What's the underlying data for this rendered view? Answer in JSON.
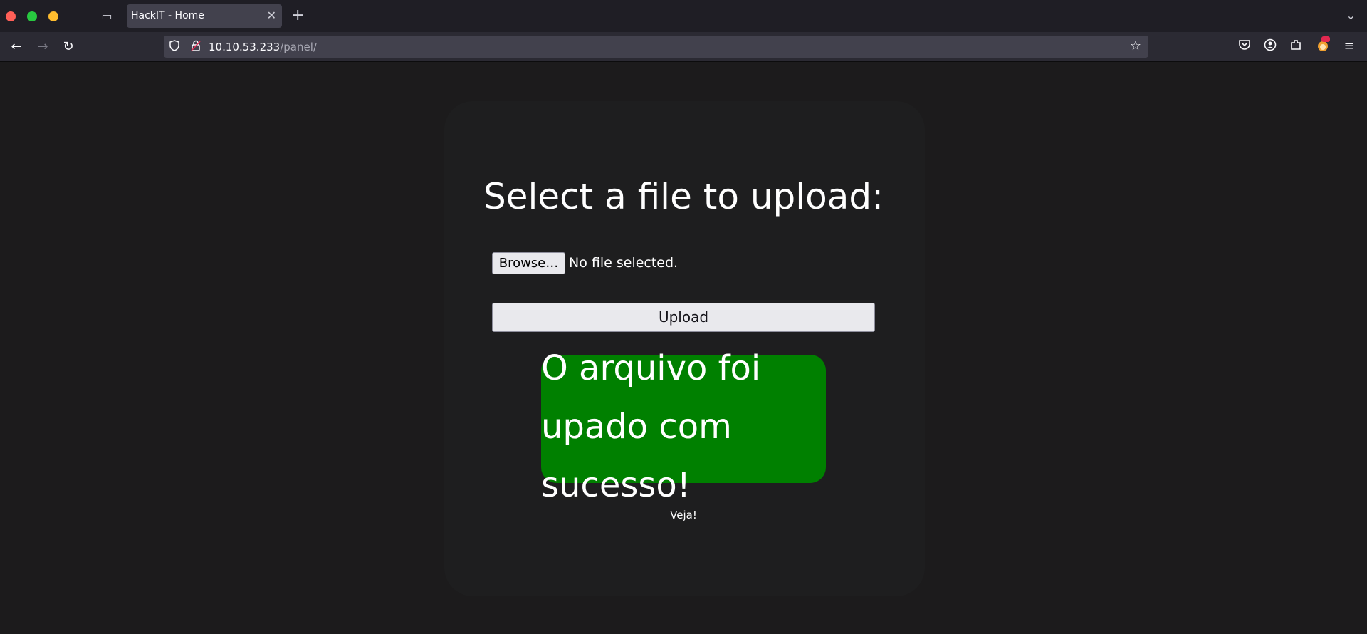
{
  "browser": {
    "tab_title": "HackIT - Home",
    "tab_close": "✕",
    "new_tab": "+",
    "tab_list": "⌄",
    "url_host": "10.10.53.233",
    "url_path": "/panel/",
    "icons": {
      "back": "←",
      "forward": "→",
      "reload": "↻",
      "star": "☆",
      "shield": "⛉",
      "lock": "🔒",
      "pocket": "◡",
      "account": "◉",
      "extensions": "⧉",
      "foxy": "◕",
      "menu": "≡",
      "tab_overview": "▭"
    }
  },
  "page": {
    "heading": "Select a file to upload:",
    "browse_label": "Browse…",
    "file_status": "No file selected.",
    "upload_label": "Upload",
    "success_message": "O arquivo foi upado com sucesso!",
    "view_link": "Veja!",
    "colors": {
      "background": "#1c1b1c",
      "card": "#1e1e1f",
      "success": "#008000",
      "text": "#ffffff"
    }
  }
}
